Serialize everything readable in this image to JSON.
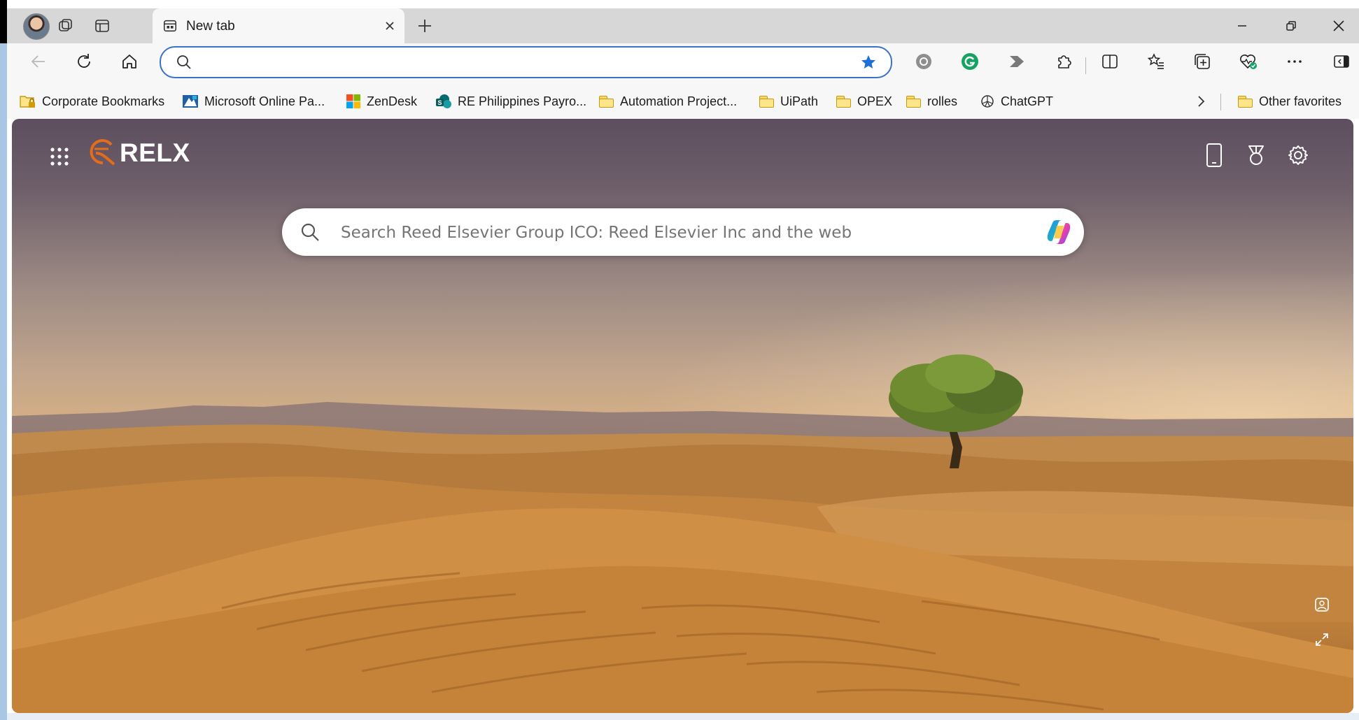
{
  "browser": {
    "tab": {
      "title": "New tab"
    },
    "address_bar": {
      "value": "",
      "placeholder": ""
    },
    "bookmarks": [
      {
        "label": "Corporate Bookmarks",
        "icon": "folder-lock-icon"
      },
      {
        "label": "Microsoft Online Pa...",
        "icon": "microsoft-online-icon"
      },
      {
        "label": "ZenDesk",
        "icon": "windows-logo-icon"
      },
      {
        "label": "RE Philippines Payro...",
        "icon": "sharepoint-icon"
      },
      {
        "label": "Automation Project...",
        "icon": "folder-icon"
      },
      {
        "label": "UiPath",
        "icon": "folder-icon"
      },
      {
        "label": "OPEX",
        "icon": "folder-icon"
      },
      {
        "label": "rolles",
        "icon": "folder-icon"
      },
      {
        "label": "ChatGPT",
        "icon": "chatgpt-icon"
      }
    ],
    "other_favorites": "Other favorites"
  },
  "ntp": {
    "logo_text": "RELX",
    "search_placeholder": "Search Reed Elsevier Group ICO: Reed Elsevier Inc and the web"
  },
  "colors": {
    "accent": "#3a72c8",
    "tabstrip": "#d7d7d7",
    "toolbar": "#f7f7f7",
    "logo_orange": "#e46c1b"
  }
}
